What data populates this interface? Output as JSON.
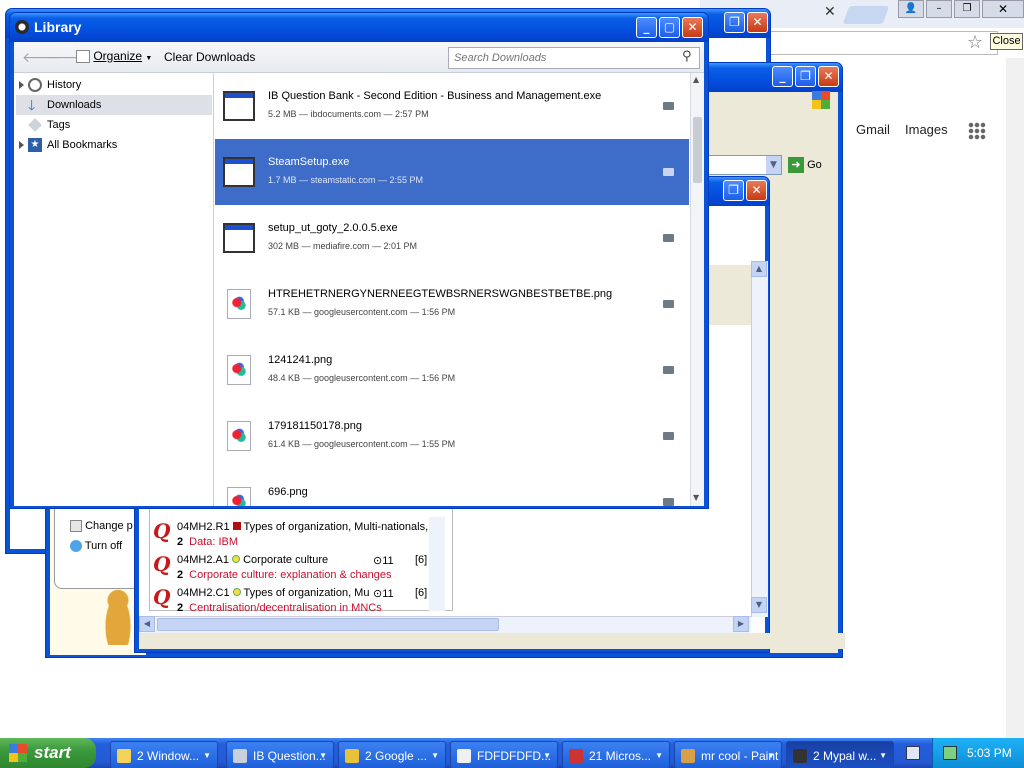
{
  "library": {
    "title": "Library",
    "toolbar": {
      "organize": "Organize",
      "clear_downloads": "Clear Downloads",
      "search_placeholder": "Search Downloads"
    },
    "sidebar": [
      {
        "label": "History",
        "icon": "clock-icon"
      },
      {
        "label": "Downloads",
        "icon": "download-arrow-icon"
      },
      {
        "label": "Tags",
        "icon": "tag-icon"
      },
      {
        "label": "All Bookmarks",
        "icon": "star-icon"
      }
    ],
    "downloads": [
      {
        "name": "IB Question Bank - Second Edition - Business and Management.exe",
        "meta": "5.2 MB — ibdocuments.com — 2:57 PM",
        "icon": "exe-window-icon"
      },
      {
        "name": "SteamSetup.exe",
        "meta": "1.7 MB — steamstatic.com — 2:55 PM",
        "icon": "exe-window-icon"
      },
      {
        "name": "setup_ut_goty_2.0.0.5.exe",
        "meta": "302 MB — mediafire.com — 2:01 PM",
        "icon": "exe-window-icon"
      },
      {
        "name": "HTREHETRNERGYNERNEEGTEWBSRNERSWGNBESTBETBE.png",
        "meta": "57.1 KB — googleusercontent.com — 1:56 PM",
        "icon": "png-file-icon"
      },
      {
        "name": "1241241.png",
        "meta": "48.4 KB — googleusercontent.com — 1:56 PM",
        "icon": "png-file-icon"
      },
      {
        "name": "179181150178.png",
        "meta": "61.4 KB — googleusercontent.com — 1:55 PM",
        "icon": "png-file-icon"
      },
      {
        "name": "696.png",
        "meta": "",
        "icon": "png-file-icon"
      }
    ]
  },
  "browser": {
    "gmail": "Gmail",
    "images": "Images",
    "close_tooltip": "Close",
    "go": "Go"
  },
  "helper": {
    "change": "Change p",
    "turn_off": "Turn off"
  },
  "questions": [
    {
      "code": "04MH2.R1",
      "title": "Types of organization, Multi-nationals,",
      "num": "2",
      "sub": "Data: IBM",
      "bullet": "red-square",
      "count": "",
      "points": ""
    },
    {
      "code": "04MH2.A1",
      "title": "Corporate culture",
      "num": "2",
      "sub": "Corporate culture: explanation & changes",
      "bullet": "yellow-circle",
      "count": "⊙11",
      "points": "[6]"
    },
    {
      "code": "04MH2.C1",
      "title": "Types of organization, Mu",
      "num": "2",
      "sub": "Centralisation/decentralisation in MNCs",
      "bullet": "yellow-circle",
      "count": "⊙11",
      "points": "[6]"
    }
  ],
  "taskbar": {
    "start": "start",
    "buttons": [
      {
        "label": "2 Window...",
        "icon": "folder-icon"
      },
      {
        "label": "IB Question...",
        "icon": "app-icon"
      },
      {
        "label": "2 Google ...",
        "icon": "chrome-icon"
      },
      {
        "label": "FDFDFDFD...",
        "icon": "document-icon"
      },
      {
        "label": "21 Micros...",
        "icon": "office-icon"
      },
      {
        "label": "mr cool - Paint",
        "icon": "paint-icon"
      },
      {
        "label": "2 Mypal w...",
        "icon": "mypal-icon"
      }
    ],
    "clock": "5:03 PM"
  },
  "colors": {
    "xp_blue": "#0a52d6",
    "selection": "#3d6cc9",
    "taskbar": "#245edb",
    "start_green": "#3c9a3c"
  }
}
